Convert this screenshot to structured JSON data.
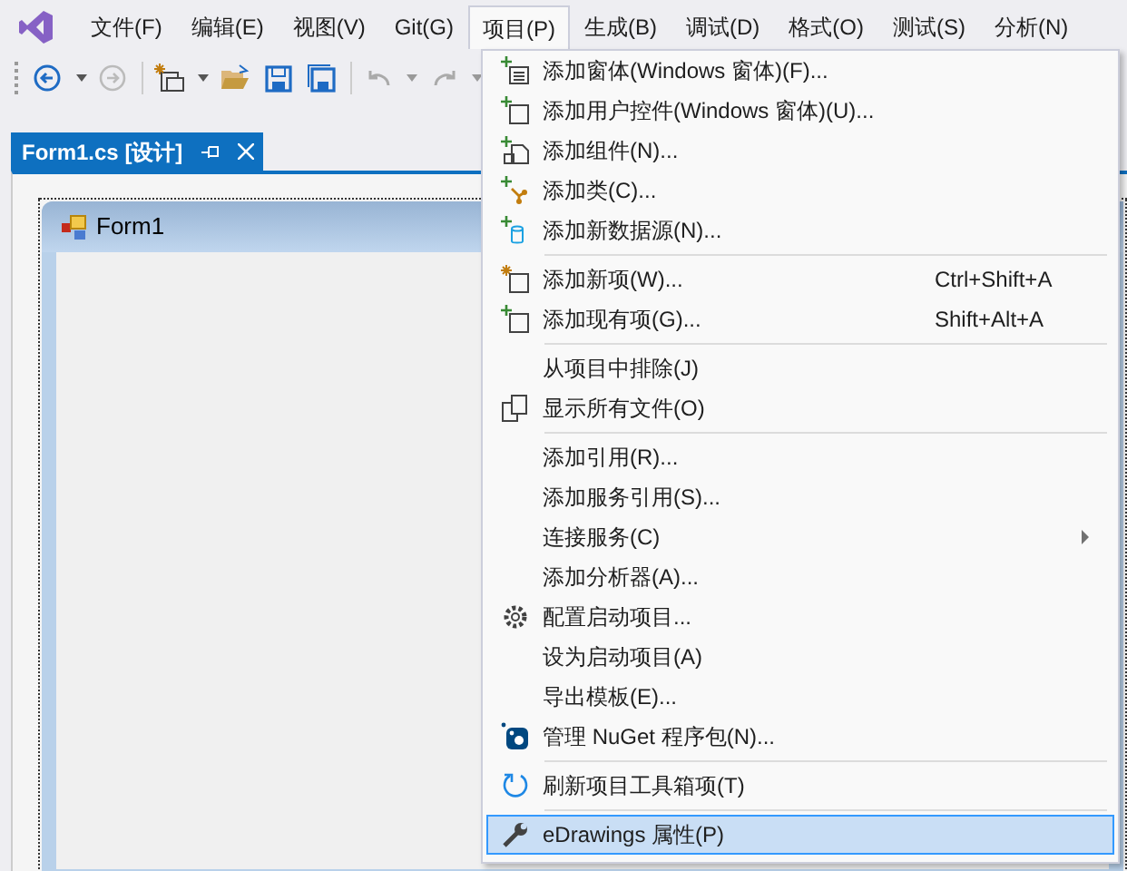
{
  "menubar": [
    {
      "label": "文件(F)",
      "selected": false
    },
    {
      "label": "编辑(E)",
      "selected": false
    },
    {
      "label": "视图(V)",
      "selected": false
    },
    {
      "label": "Git(G)",
      "selected": false
    },
    {
      "label": "项目(P)",
      "selected": true
    },
    {
      "label": "生成(B)",
      "selected": false
    },
    {
      "label": "调试(D)",
      "selected": false
    },
    {
      "label": "格式(O)",
      "selected": false
    },
    {
      "label": "测试(S)",
      "selected": false
    },
    {
      "label": "分析(N)",
      "selected": false
    }
  ],
  "document_tab": {
    "label": "Form1.cs [设计]",
    "selected": true
  },
  "form": {
    "title": "Form1"
  },
  "menu": [
    {
      "kind": "item",
      "label": "添加窗体(Windows 窗体)(F)...",
      "selected": false
    },
    {
      "kind": "item",
      "label": "添加用户控件(Windows 窗体)(U)...",
      "selected": false
    },
    {
      "kind": "item",
      "label": "添加组件(N)...",
      "selected": false
    },
    {
      "kind": "item",
      "label": "添加类(C)...",
      "selected": false
    },
    {
      "kind": "item",
      "label": "添加新数据源(N)...",
      "selected": false
    },
    {
      "kind": "separator"
    },
    {
      "kind": "item",
      "label": "添加新项(W)...",
      "shortcut": "Ctrl+Shift+A",
      "selected": false
    },
    {
      "kind": "item",
      "label": "添加现有项(G)...",
      "shortcut": "Shift+Alt+A",
      "selected": false
    },
    {
      "kind": "separator"
    },
    {
      "kind": "item",
      "label": "从项目中排除(J)",
      "selected": false
    },
    {
      "kind": "item",
      "label": "显示所有文件(O)",
      "selected": false
    },
    {
      "kind": "separator"
    },
    {
      "kind": "item",
      "label": "添加引用(R)...",
      "selected": false
    },
    {
      "kind": "item",
      "label": "添加服务引用(S)...",
      "selected": false
    },
    {
      "kind": "submenu",
      "label": "连接服务(C)",
      "selected": false
    },
    {
      "kind": "item",
      "label": "添加分析器(A)...",
      "selected": false
    },
    {
      "kind": "item",
      "label": "配置启动项目...",
      "selected": false
    },
    {
      "kind": "item",
      "label": "设为启动项目(A)",
      "selected": false
    },
    {
      "kind": "item",
      "label": "导出模板(E)...",
      "selected": false
    },
    {
      "kind": "item",
      "label": "管理 NuGet 程序包(N)...",
      "selected": false
    },
    {
      "kind": "separator"
    },
    {
      "kind": "item",
      "label": "刷新项目工具箱项(T)",
      "selected": false
    },
    {
      "kind": "separator"
    },
    {
      "kind": "item",
      "label": "eDrawings 属性(P)",
      "selected": true
    }
  ]
}
